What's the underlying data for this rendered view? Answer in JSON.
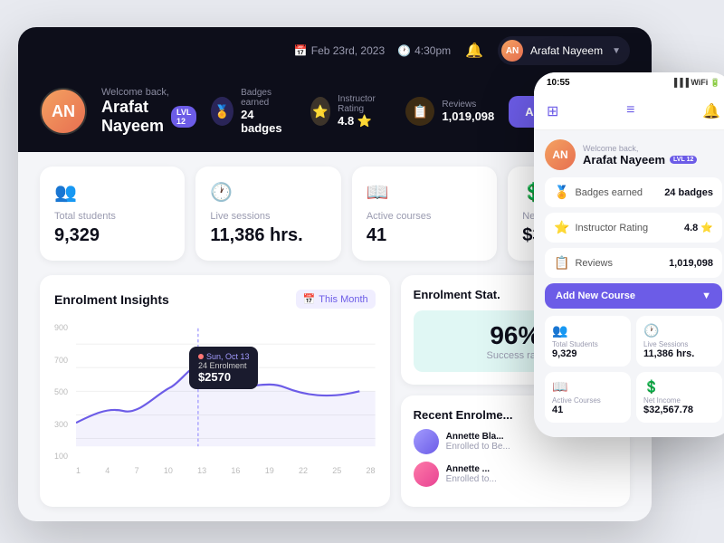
{
  "header": {
    "date": "Feb 23rd, 2023",
    "time": "4:30pm",
    "user_name": "Arafat Nayeem"
  },
  "profile": {
    "welcome_text": "Welcome back,",
    "name": "Arafat Nayeem",
    "level": "LVL 12",
    "avatar_initials": "AN"
  },
  "stats_bar": {
    "badges_label": "Badges earned",
    "badges_value": "24 badges",
    "rating_label": "Instructor Rating",
    "rating_value": "4.8 ⭐",
    "reviews_label": "Reviews",
    "reviews_value": "1,019,098"
  },
  "add_course_btn": "Add New Course",
  "stat_cards": [
    {
      "icon": "👥",
      "label": "Total students",
      "value": "9,329"
    },
    {
      "icon": "🕐",
      "label": "Live sessions",
      "value": "11,386 hrs."
    },
    {
      "icon": "📖",
      "label": "Active courses",
      "value": "41"
    },
    {
      "icon": "💲",
      "label": "Net Income",
      "value": "$3..."
    }
  ],
  "chart": {
    "title": "Enrolment Insights",
    "filter": "This Month",
    "tooltip": {
      "date": "Sun, Oct 13",
      "enroll": "24 Enrolment",
      "amount": "$2570"
    },
    "y_labels": [
      "900",
      "700",
      "500",
      "300",
      "100"
    ],
    "x_labels": [
      "1",
      "4",
      "7",
      "10",
      "13",
      "16",
      "19",
      "22",
      "25",
      "28"
    ]
  },
  "enrolment_stat": {
    "title": "Enrolment Stat.",
    "success_rate": "96%",
    "success_label": "Success rate"
  },
  "recent_enrolments": {
    "title": "Recent Enrolme...",
    "items": [
      {
        "name": "Annette Bla...",
        "sub": "Enrolled to Be...",
        "color": "#a29bfe"
      },
      {
        "name": "Annette ...",
        "sub": "Enrolled to...",
        "color": "#fd79a8"
      }
    ]
  },
  "mobile": {
    "time": "10:55",
    "welcome": "Welcome back,",
    "name": "Arafat Nayeem",
    "level": "LVL 12",
    "badges_label": "Badges earned",
    "badges_value": "24 badges",
    "rating_label": "Instructor Rating",
    "rating_value": "4.8 ⭐",
    "reviews_label": "Reviews",
    "reviews_value": "1,019,098",
    "add_btn": "Add New Course",
    "cards": [
      {
        "icon": "👥",
        "label": "Total Students",
        "value": "9,329"
      },
      {
        "icon": "🕐",
        "label": "Live Sessions",
        "value": "11,386 hrs."
      },
      {
        "icon": "📖",
        "label": "Active Courses",
        "value": "41"
      },
      {
        "icon": "💲",
        "label": "Net Income",
        "value": "$32,567.78"
      }
    ]
  }
}
